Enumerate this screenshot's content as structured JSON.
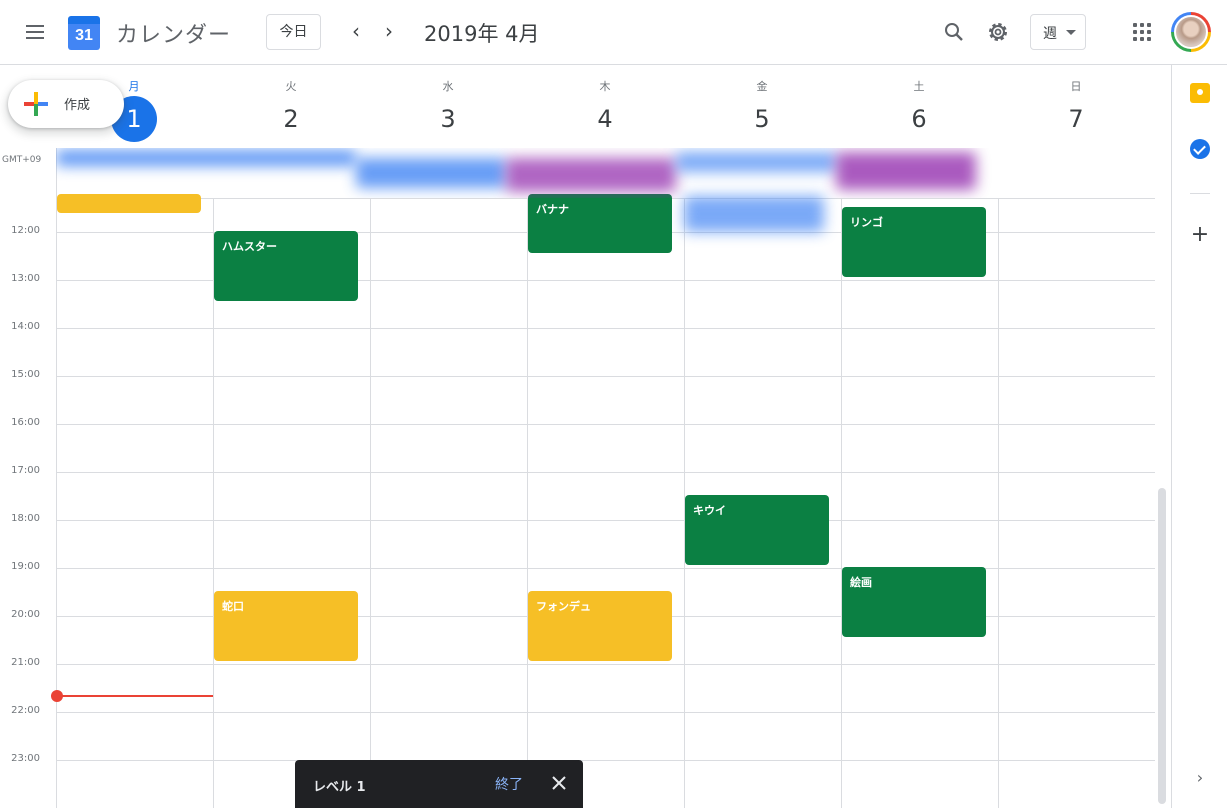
{
  "header": {
    "app_name": "カレンダー",
    "logo_day": "31",
    "today_label": "今日",
    "period": "2019年 4月",
    "view_label": "週"
  },
  "create": {
    "label": "作成"
  },
  "timezone": "GMT+09",
  "days": [
    {
      "dow": "月",
      "num": "1",
      "today": true
    },
    {
      "dow": "火",
      "num": "2"
    },
    {
      "dow": "水",
      "num": "3"
    },
    {
      "dow": "木",
      "num": "4"
    },
    {
      "dow": "金",
      "num": "5"
    },
    {
      "dow": "土",
      "num": "6"
    },
    {
      "dow": "日",
      "num": "7"
    }
  ],
  "hours": [
    "12:00",
    "13:00",
    "14:00",
    "15:00",
    "16:00",
    "17:00",
    "18:00",
    "19:00",
    "20:00",
    "21:00",
    "22:00",
    "23:00"
  ],
  "events": [
    {
      "title": "",
      "day": 0,
      "start": "11:00",
      "end": "11:40",
      "color": "#f6bf26"
    },
    {
      "title": "ハムスター",
      "day": 1,
      "start": "12:00",
      "end": "13:30",
      "color": "#0b8043"
    },
    {
      "title": "バナナ",
      "day": 3,
      "start": "11:00",
      "end": "12:30",
      "color": "#0b8043"
    },
    {
      "title": "リンゴ",
      "day": 5,
      "start": "11:30",
      "end": "13:00",
      "color": "#0b8043"
    },
    {
      "title": "キウイ",
      "day": 4,
      "start": "17:30",
      "end": "19:00",
      "color": "#0b8043"
    },
    {
      "title": "絵画",
      "day": 5,
      "start": "19:00",
      "end": "20:30",
      "color": "#0b8043"
    },
    {
      "title": "蛇口",
      "day": 1,
      "start": "19:30",
      "end": "21:00",
      "color": "#f6bf26"
    },
    {
      "title": "フォンデュ",
      "day": 3,
      "start": "19:30",
      "end": "21:00",
      "color": "#f6bf26"
    }
  ],
  "snackbar": {
    "text": "レベル 1",
    "action": "終了"
  },
  "colors": {
    "accent": "#1a73e8",
    "event_green": "#0b8043",
    "event_yellow": "#f6bf26",
    "now_line": "#ea4335"
  }
}
